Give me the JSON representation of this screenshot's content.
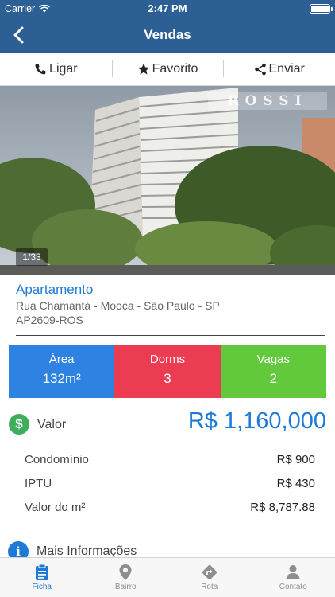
{
  "status": {
    "carrier": "Carrier",
    "time": "2:47 PM"
  },
  "nav": {
    "title": "Vendas"
  },
  "actions": [
    {
      "label": "Ligar",
      "icon": "phone-icon"
    },
    {
      "label": "Favorito",
      "icon": "star-icon"
    },
    {
      "label": "Enviar",
      "icon": "share-icon"
    }
  ],
  "photo": {
    "counter": "1/33",
    "logo_text": "ROSSI"
  },
  "property": {
    "type": "Apartamento",
    "address": "Rua Chamantá - Mooca - São Paulo - SP",
    "code": "AP2609-ROS"
  },
  "stats": {
    "area": {
      "label": "Área",
      "value": "132m²"
    },
    "dorms": {
      "label": "Dorms",
      "value": "3"
    },
    "vagas": {
      "label": "Vagas",
      "value": "2"
    }
  },
  "valor": {
    "label": "Valor",
    "price": "R$ 1,160,000"
  },
  "details": [
    {
      "label": "Condomínio",
      "value": "R$ 900"
    },
    {
      "label": "IPTU",
      "value": "R$ 430"
    },
    {
      "label": "Valor do m²",
      "value": "R$ 8,787.88"
    }
  ],
  "more": {
    "label": "Mais Informações"
  },
  "tabs": [
    {
      "label": "Ficha",
      "icon": "clipboard-icon",
      "active": true
    },
    {
      "label": "Bairro",
      "icon": "map-pin-icon",
      "active": false
    },
    {
      "label": "Rota",
      "icon": "route-icon",
      "active": false
    },
    {
      "label": "Contato",
      "icon": "person-icon",
      "active": false
    }
  ],
  "colors": {
    "nav": "#2c5f93",
    "accent": "#1e7ad6",
    "area": "#2d82e2",
    "dorms": "#ec3c52",
    "vagas": "#62c93c",
    "money": "#3fae5a"
  }
}
